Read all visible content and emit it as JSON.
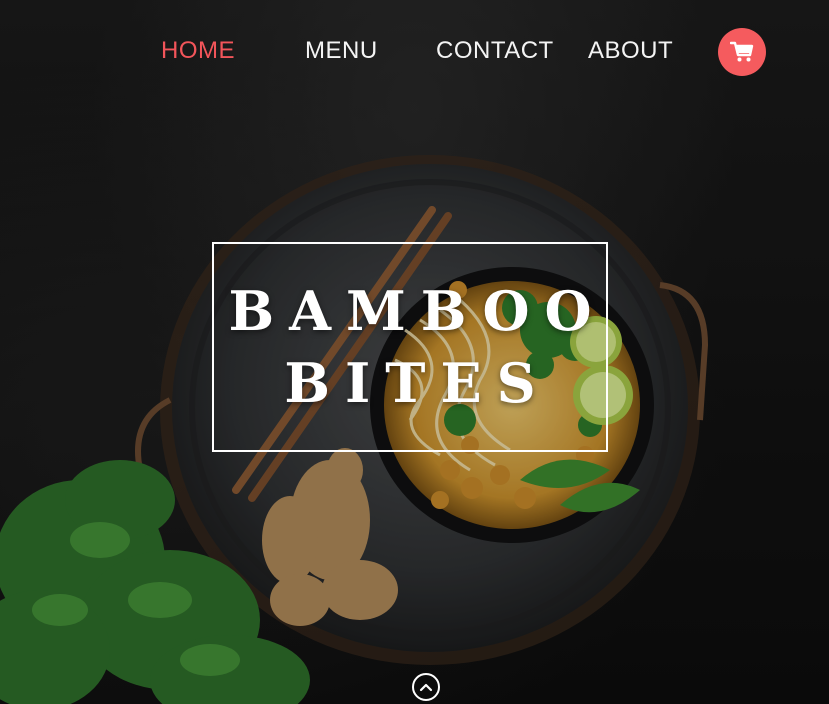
{
  "nav": {
    "items": [
      {
        "label": "HOME",
        "active": true
      },
      {
        "label": "MENU",
        "active": false
      },
      {
        "label": "CONTACT",
        "active": false
      },
      {
        "label": "ABOUT",
        "active": false
      }
    ],
    "cart_icon": "shopping-cart-icon"
  },
  "hero": {
    "title_line1": "BAMBOO",
    "title_line2": "BITES",
    "scroll_icon": "chevron-up-circle-icon"
  },
  "colors": {
    "accent": "#f55b5e",
    "active_link": "#f2555a",
    "text": "#ffffff",
    "background": "#141414"
  }
}
